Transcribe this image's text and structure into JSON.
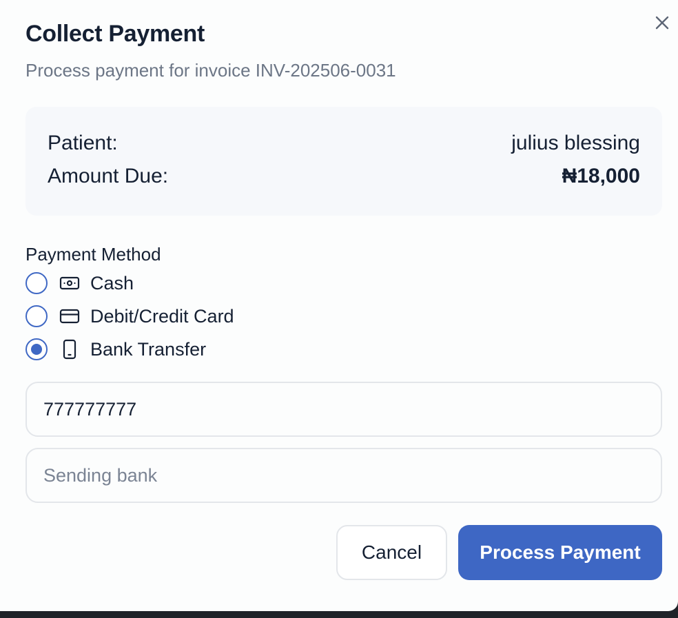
{
  "dialog": {
    "title": "Collect Payment",
    "subtitle": "Process payment for invoice INV-202506-0031",
    "close_icon": "close-icon"
  },
  "summary": {
    "patient_label": "Patient:",
    "patient_value": "julius blessing",
    "amount_label": "Amount Due:",
    "amount_value": "₦18,000"
  },
  "payment_method": {
    "label": "Payment Method",
    "options": [
      {
        "label": "Cash",
        "icon": "banknote-icon",
        "selected": false
      },
      {
        "label": "Debit/Credit Card",
        "icon": "credit-card-icon",
        "selected": false
      },
      {
        "label": "Bank Transfer",
        "icon": "smartphone-icon",
        "selected": true
      }
    ]
  },
  "fields": {
    "reference_value": "777777777",
    "bank_placeholder": "Sending bank",
    "bank_value": ""
  },
  "buttons": {
    "cancel": "Cancel",
    "process": "Process Payment"
  },
  "colors": {
    "accent": "#3e67c4",
    "text": "#152033",
    "muted": "#6c7686",
    "summary_bg": "#f6f8fb",
    "border": "#e3e6ea"
  }
}
